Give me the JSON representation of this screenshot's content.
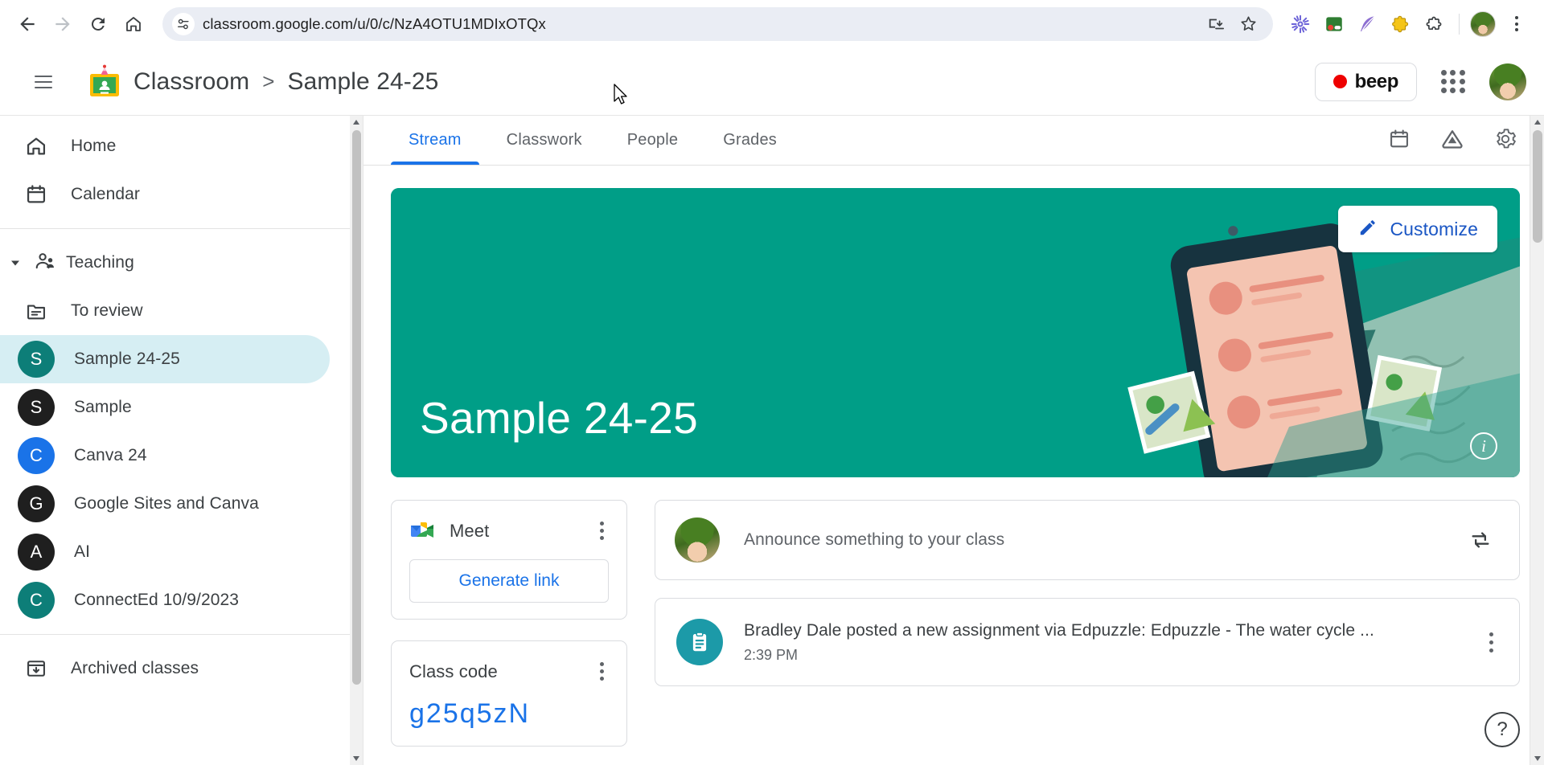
{
  "browser": {
    "url": "classroom.google.com/u/0/c/NzA4OTU1MDIxOTQx",
    "back_label": "Back",
    "forward_label": "Forward",
    "reload_label": "Reload",
    "home_label": "Home",
    "site_settings_label": "View site information",
    "install_label": "Install page as app",
    "bookmark_label": "Bookmark this tab",
    "extensions": [
      {
        "name": "asterisk-extension",
        "label": "Extension"
      },
      {
        "name": "screen-recorder-extension",
        "label": "Extension"
      },
      {
        "name": "quill-extension",
        "label": "Extension"
      },
      {
        "name": "puzzle-yellow-extension",
        "label": "Extension"
      },
      {
        "name": "extensions-button",
        "label": "Extensions"
      }
    ],
    "profile_label": "Profile",
    "menu_label": "Customize and control Google Chrome"
  },
  "appbar": {
    "menu_label": "Main menu",
    "logo_label": "Google Classroom",
    "brand": "Classroom",
    "separator": ">",
    "class_name": "Sample 24-25",
    "beep_label": "beep",
    "apps_label": "Google apps",
    "account_label": "Google Account"
  },
  "sidebar": {
    "top_items": [
      {
        "label": "Home",
        "icon": "home-icon",
        "active": false
      },
      {
        "label": "Calendar",
        "icon": "calendar-icon",
        "active": false
      }
    ],
    "group": {
      "label": "Teaching",
      "icon": "teaching-icon",
      "expanded": true
    },
    "teaching_items": [
      {
        "label": "To review",
        "icon": "to-review-icon",
        "type": "icon",
        "active": false
      },
      {
        "label": "Sample 24-25",
        "initial": "S",
        "color": "#0d7e78",
        "type": "class",
        "active": true
      },
      {
        "label": "Sample",
        "initial": "S",
        "color": "#1f1f1f",
        "type": "class",
        "active": false
      },
      {
        "label": "Canva 24",
        "initial": "C",
        "color": "#1a73e8",
        "type": "class",
        "active": false
      },
      {
        "label": "Google Sites and Canva",
        "initial": "G",
        "color": "#1f1f1f",
        "type": "class",
        "active": false
      },
      {
        "label": "AI",
        "initial": "A",
        "color": "#1f1f1f",
        "type": "class",
        "active": false
      },
      {
        "label": "ConnectEd 10/9/2023",
        "initial": "C",
        "color": "#0d7e78",
        "type": "class",
        "active": false
      }
    ],
    "bottom_items": [
      {
        "label": "Archived classes",
        "icon": "archive-icon",
        "active": false
      }
    ]
  },
  "tabs": [
    {
      "label": "Stream",
      "active": true
    },
    {
      "label": "Classwork",
      "active": false
    },
    {
      "label": "People",
      "active": false
    },
    {
      "label": "Grades",
      "active": false
    }
  ],
  "tab_actions": [
    {
      "name": "calendar-icon",
      "label": "Open class calendar"
    },
    {
      "name": "drive-folder-icon",
      "label": "Open class Drive folder"
    },
    {
      "name": "gear-icon",
      "label": "Class settings"
    }
  ],
  "banner": {
    "title": "Sample 24-25",
    "customize_label": "Customize",
    "info_label": "Select theme info",
    "color": "#009e87"
  },
  "meet_card": {
    "title": "Meet",
    "generate_label": "Generate link",
    "menu_label": "Meet options"
  },
  "class_code_card": {
    "title": "Class code",
    "code": "g25q5zN",
    "menu_label": "Class code options"
  },
  "stream": {
    "announce_placeholder": "Announce something to your class",
    "reuse_label": "Reuse post",
    "posts": [
      {
        "title": "Bradley Dale posted a new assignment via Edpuzzle: Edpuzzle - The water cycle ...",
        "time": "2:39 PM",
        "icon": "assignment-icon",
        "menu_label": "Post options"
      }
    ]
  },
  "help": {
    "label": "?"
  },
  "colors": {
    "accent_blue": "#1a73e8",
    "teal": "#009e87",
    "active_pill": "#d6eef3"
  }
}
